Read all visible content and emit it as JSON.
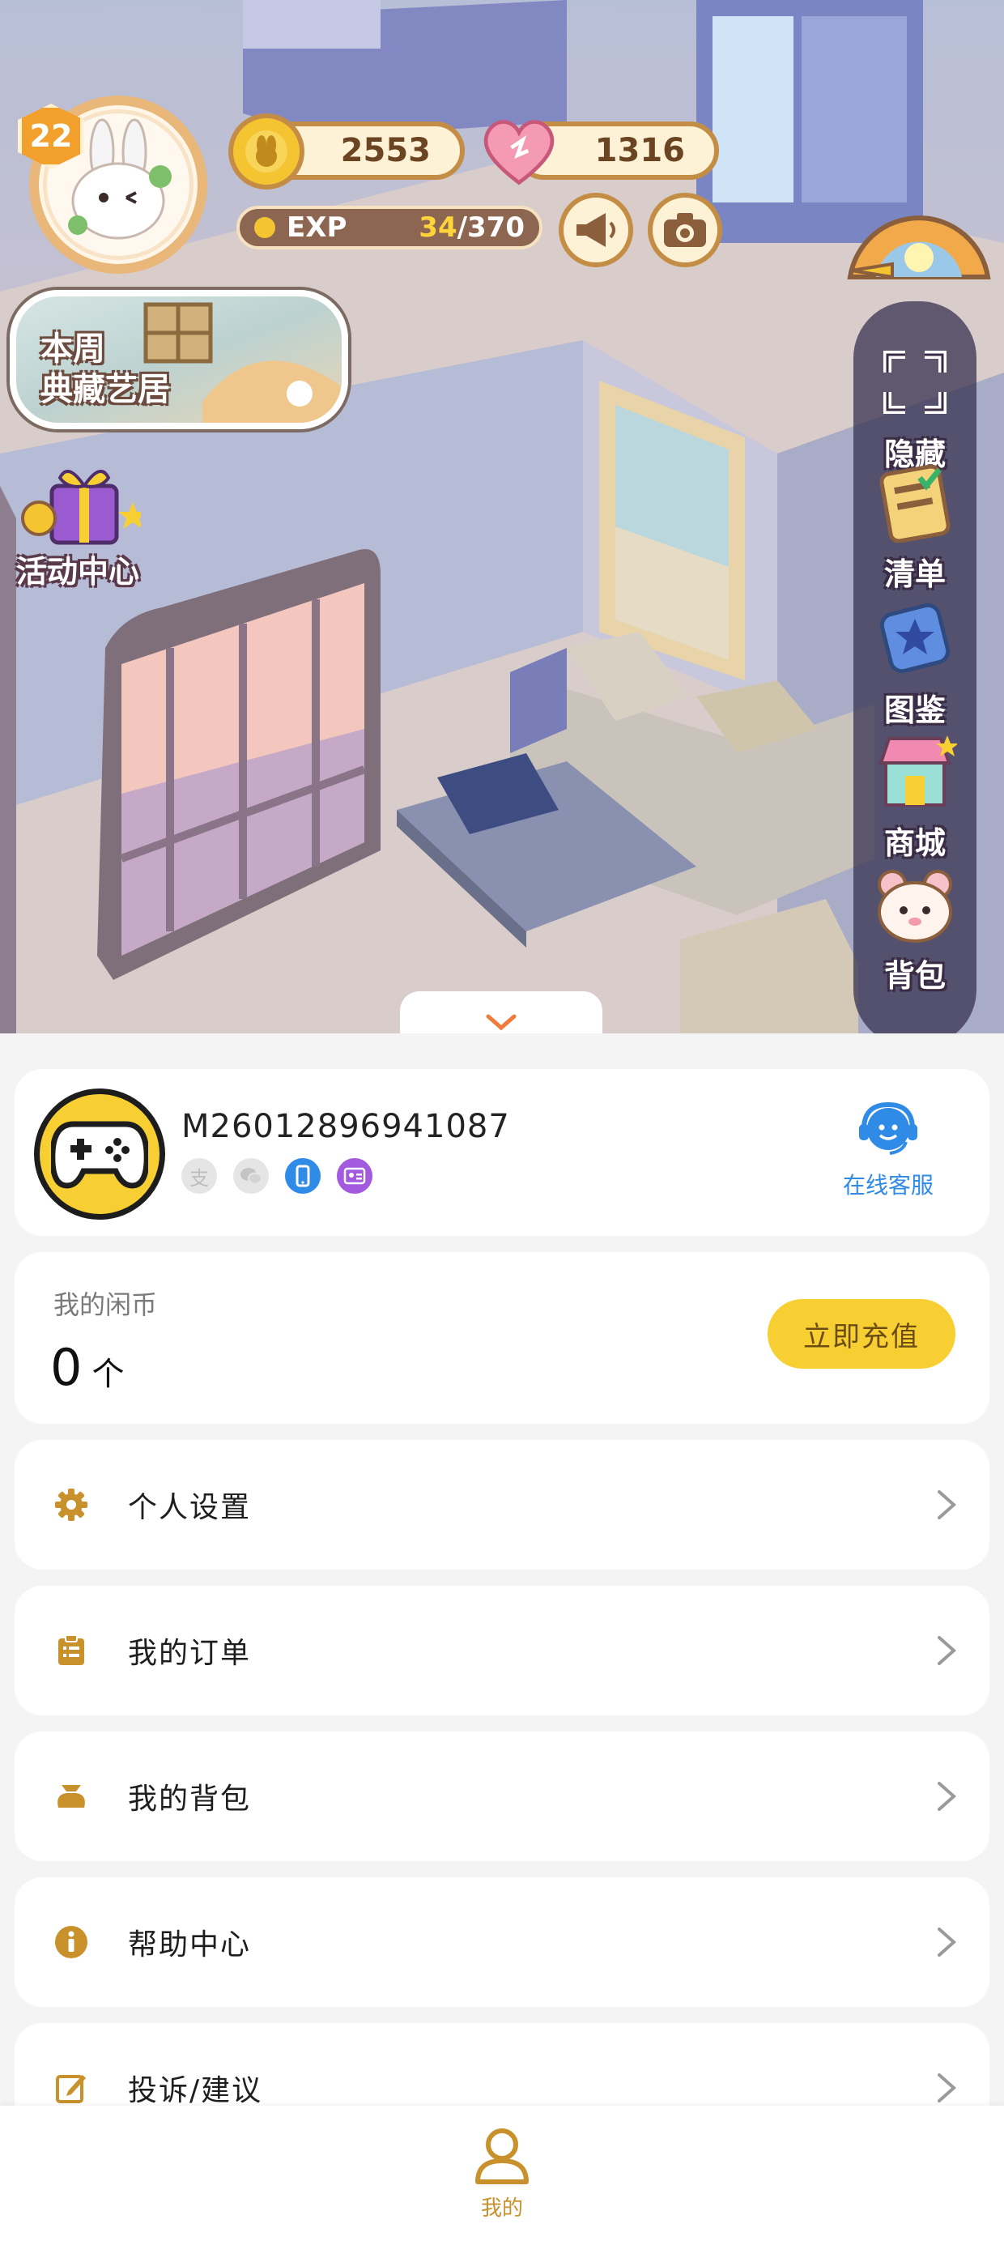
{
  "hud": {
    "level": "22",
    "coins": "2553",
    "hearts": "1316",
    "exp_label": "EXP",
    "exp_current": "34",
    "exp_total": "/370"
  },
  "week_banner": {
    "line1": "本周",
    "line2": "典藏艺居"
  },
  "activity_center": {
    "label": "活动中心"
  },
  "side_menu": [
    {
      "label": "隐藏",
      "icon": "fullscreen-corners-icon"
    },
    {
      "label": "清单",
      "icon": "checklist-icon"
    },
    {
      "label": "图鉴",
      "icon": "star-book-icon"
    },
    {
      "label": "商城",
      "icon": "shop-awning-icon"
    },
    {
      "label": "背包",
      "icon": "bear-bag-icon"
    }
  ],
  "profile": {
    "user_id": "M26012896941087",
    "login_methods": [
      "alipay-icon",
      "wechat-icon",
      "phone-icon",
      "id-card-icon"
    ],
    "login_glyphs": [
      "支",
      "",
      "",
      ""
    ],
    "service_label": "在线客服"
  },
  "coins": {
    "title": "我的闲币",
    "value": "0",
    "unit": "个",
    "recharge_label": "立即充值"
  },
  "menu": [
    {
      "label": "个人设置",
      "icon": "gear-icon"
    },
    {
      "label": "我的订单",
      "icon": "clipboard-icon"
    },
    {
      "label": "我的背包",
      "icon": "pouch-icon"
    },
    {
      "label": "帮助中心",
      "icon": "info-icon"
    },
    {
      "label": "投诉/建议",
      "icon": "edit-icon"
    }
  ],
  "bottom_nav": {
    "mine_label": "我的"
  },
  "colors": {
    "accent": "#c8912c",
    "button_yellow": "#f7cf33",
    "service_blue": "#2f8be6"
  }
}
